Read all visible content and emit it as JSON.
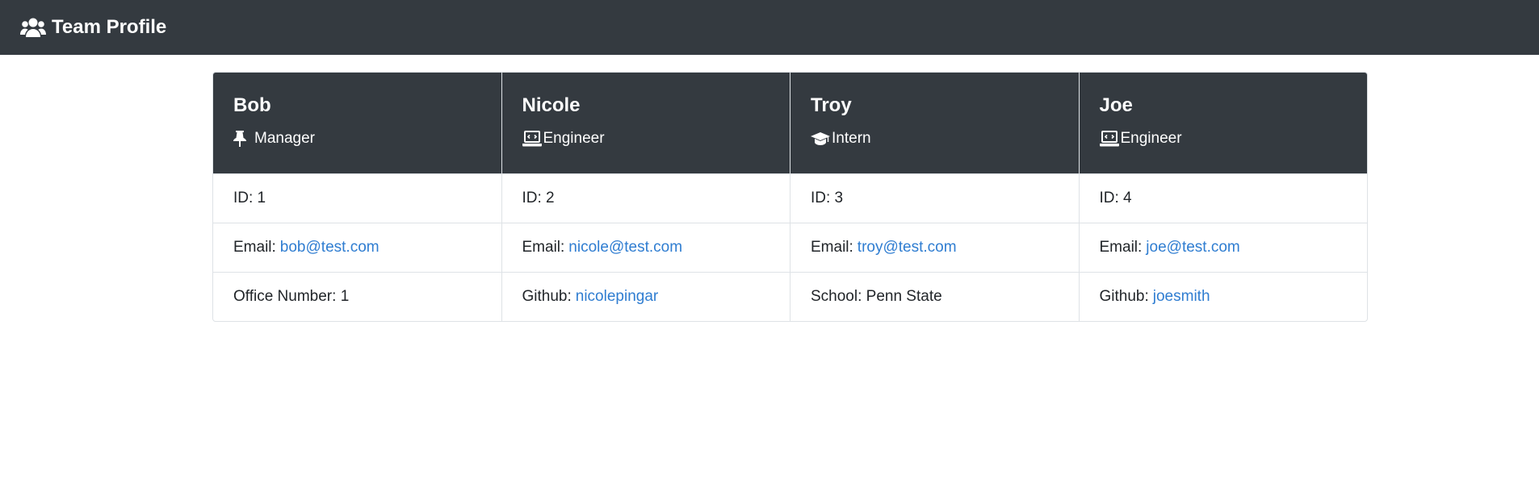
{
  "navbar": {
    "title": "Team Profile",
    "icon": "users-icon"
  },
  "members": [
    {
      "name": "Bob",
      "role": "Manager",
      "role_icon": "pushpin-icon",
      "id_text": "ID: 1",
      "email_label": "Email:",
      "email": "bob@test.com",
      "extra_label": "Office Number: 1",
      "extra_link": ""
    },
    {
      "name": "Nicole",
      "role": "Engineer",
      "role_icon": "laptop-code-icon",
      "id_text": "ID: 2",
      "email_label": "Email:",
      "email": "nicole@test.com",
      "extra_label": "Github:",
      "extra_link": "nicolepingar"
    },
    {
      "name": "Troy",
      "role": "Intern",
      "role_icon": "graduation-cap-icon",
      "id_text": "ID: 3",
      "email_label": "Email:",
      "email": "troy@test.com",
      "extra_label": "School: Penn State",
      "extra_link": ""
    },
    {
      "name": "Joe",
      "role": "Engineer",
      "role_icon": "laptop-code-icon",
      "id_text": "ID: 4",
      "email_label": "Email:",
      "email": "joe@test.com",
      "extra_label": "Github:",
      "extra_link": "joesmith"
    }
  ]
}
